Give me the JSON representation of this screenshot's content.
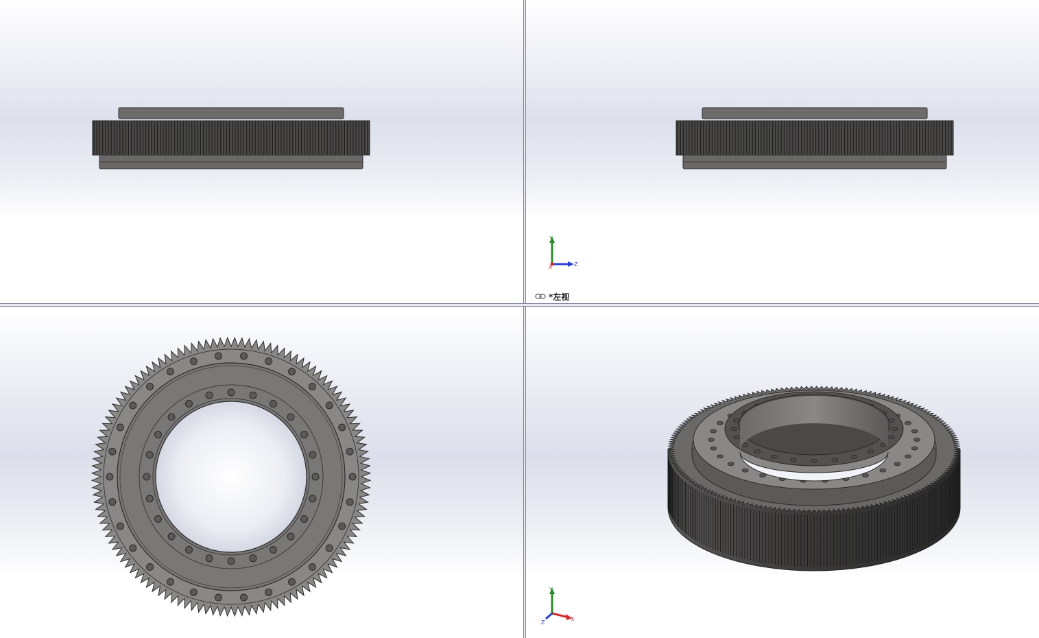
{
  "viewports": {
    "top_left": {
      "name": "front-view"
    },
    "top_right": {
      "name": "left-view",
      "label": "*左视"
    },
    "bottom_left": {
      "name": "top-view"
    },
    "bottom_right": {
      "name": "isometric-view"
    }
  },
  "triads": {
    "left_view": {
      "axes": [
        "Y",
        "X",
        "Z"
      ]
    },
    "isometric": {
      "axes": [
        "Y",
        "Z",
        "X"
      ]
    }
  },
  "model": {
    "gear_teeth_top_view": 120,
    "outer_bolt_holes": 30,
    "inner_bolt_holes": 24,
    "colors": {
      "body": "#7d7b79",
      "dark": "#3a3a3a",
      "face": "#8a8886"
    }
  },
  "icons": {
    "view_link": "link-icon",
    "triad": "coordinate-triad-icon"
  }
}
